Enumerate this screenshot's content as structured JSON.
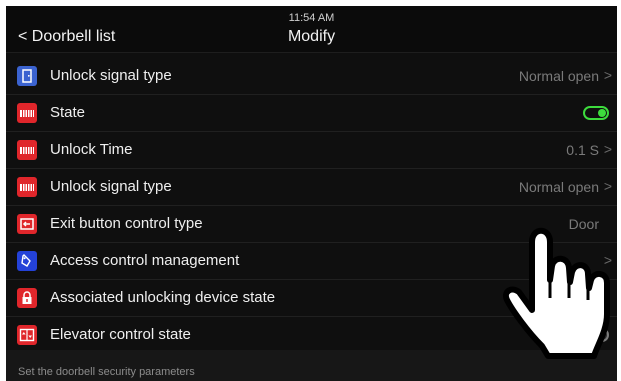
{
  "header": {
    "time": "11:54 AM",
    "back_label": "< Doorbell list",
    "title": "Modify"
  },
  "rows": [
    {
      "label": "Unlock signal type",
      "value": "Normal open",
      "icon": "door-icon",
      "color": "#3b63d0"
    },
    {
      "label": "State",
      "toggle": "on",
      "icon": "lock-relay-icon",
      "color": "#e0262b"
    },
    {
      "label": "Unlock Time",
      "value": "0.1 S",
      "icon": "lock-relay-icon",
      "color": "#e0262b"
    },
    {
      "label": "Unlock signal type",
      "value": "Normal open",
      "icon": "lock-relay-icon",
      "color": "#e0262b"
    },
    {
      "label": "Exit button control type",
      "value": "Door",
      "icon": "exit-button-icon",
      "color": "#e0262b"
    },
    {
      "label": "Access control management",
      "value": "",
      "icon": "tag-icon",
      "color": "#2442d8"
    },
    {
      "label": "Associated unlocking device state",
      "toggle": "off",
      "icon": "padlock-icon",
      "color": "#e0262b"
    },
    {
      "label": "Elevator control state",
      "toggle": "off",
      "icon": "elevator-icon",
      "color": "#e0262b"
    }
  ],
  "chevron": ">",
  "footer": {
    "hint": "Set the doorbell security parameters"
  },
  "colors": {
    "background": "#0f0f0f",
    "toggle_on": "#3ddc3d",
    "icon_red": "#e0262b",
    "icon_blue": "#3b63d0"
  }
}
